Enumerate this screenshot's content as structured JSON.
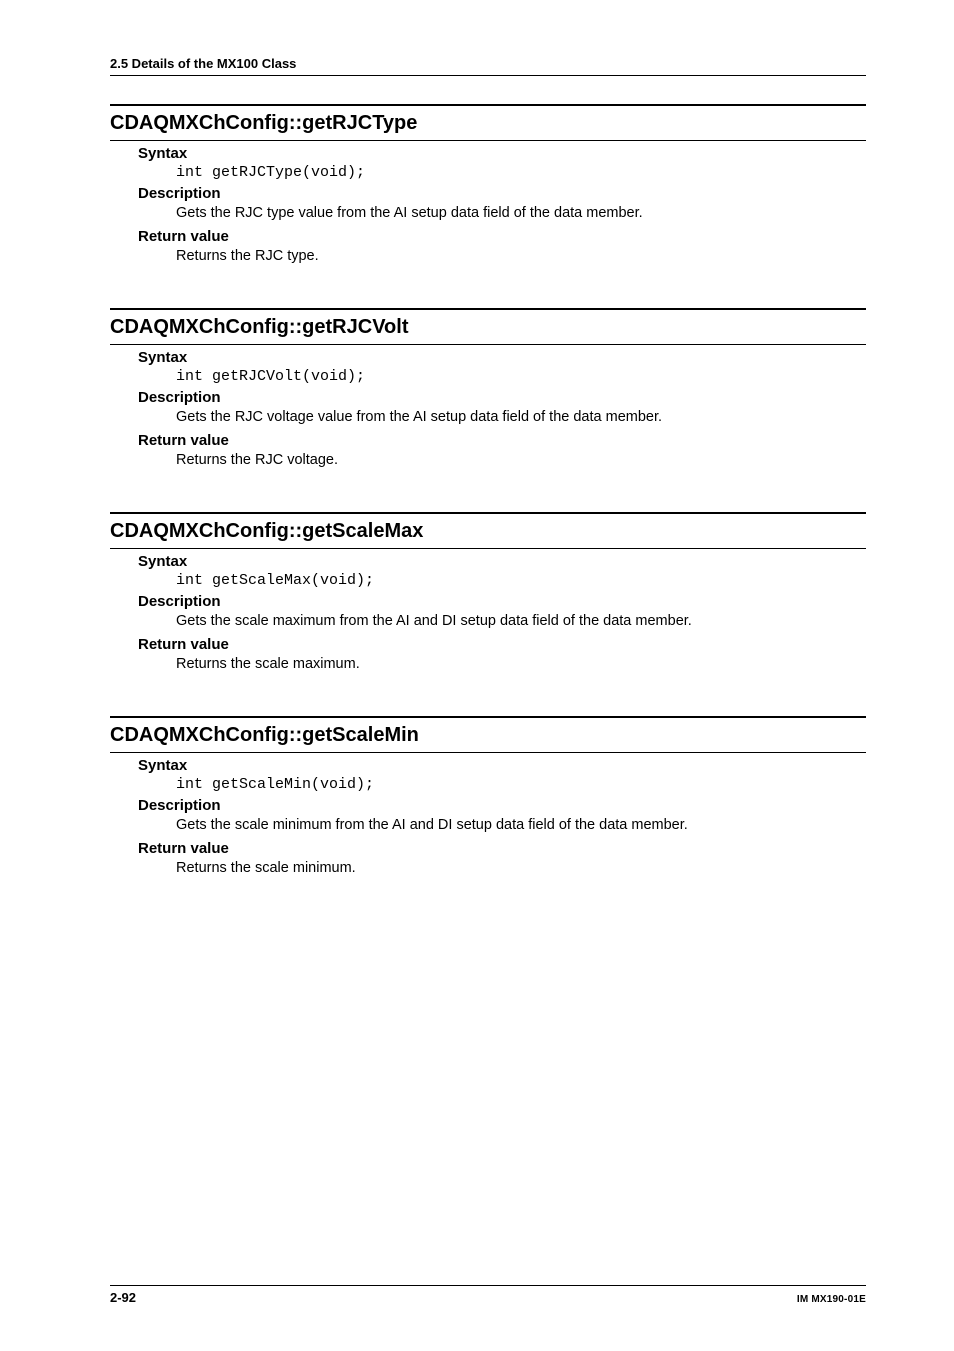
{
  "header": {
    "breadcrumb": "2.5  Details of the MX100 Class"
  },
  "sections": [
    {
      "title": "CDAQMXChConfig::getRJCType",
      "blocks": [
        {
          "type": "sub",
          "text": "Syntax"
        },
        {
          "type": "code",
          "text": "int getRJCType(void);"
        },
        {
          "type": "sub",
          "text": "Description"
        },
        {
          "type": "body",
          "text": "Gets the RJC type value from the AI setup data field of the data member."
        },
        {
          "type": "sub",
          "text": "Return value"
        },
        {
          "type": "body",
          "text": "Returns the RJC type."
        }
      ]
    },
    {
      "title": "CDAQMXChConfig::getRJCVolt",
      "blocks": [
        {
          "type": "sub",
          "text": "Syntax"
        },
        {
          "type": "code",
          "text": "int getRJCVolt(void);"
        },
        {
          "type": "sub",
          "text": "Description"
        },
        {
          "type": "body",
          "text": "Gets the RJC voltage value from the AI setup data field of the data member."
        },
        {
          "type": "sub",
          "text": "Return value"
        },
        {
          "type": "body",
          "text": "Returns the RJC voltage."
        }
      ]
    },
    {
      "title": "CDAQMXChConfig::getScaleMax",
      "blocks": [
        {
          "type": "sub",
          "text": "Syntax"
        },
        {
          "type": "code",
          "text": "int getScaleMax(void);"
        },
        {
          "type": "sub",
          "text": "Description"
        },
        {
          "type": "body",
          "text": "Gets the scale maximum from the AI and DI setup data field of the data member."
        },
        {
          "type": "sub",
          "text": "Return value"
        },
        {
          "type": "body",
          "text": "Returns the scale maximum."
        }
      ]
    },
    {
      "title": "CDAQMXChConfig::getScaleMin",
      "blocks": [
        {
          "type": "sub",
          "text": "Syntax"
        },
        {
          "type": "code",
          "text": "int getScaleMin(void);"
        },
        {
          "type": "sub",
          "text": "Description"
        },
        {
          "type": "body",
          "text": "Gets the scale minimum from the AI and DI setup data field of the data member."
        },
        {
          "type": "sub",
          "text": "Return value"
        },
        {
          "type": "body",
          "text": "Returns the scale minimum."
        }
      ]
    }
  ],
  "footer": {
    "page": "2-92",
    "doc_id": "IM MX190-01E"
  }
}
